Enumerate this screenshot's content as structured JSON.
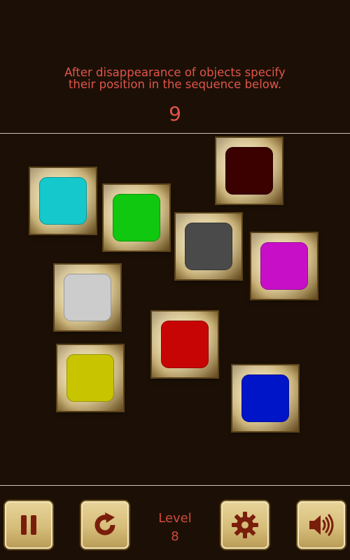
{
  "instruction": {
    "line1": "After disappearance of objects specify",
    "line2": "their position in the sequence below."
  },
  "counter": "9",
  "tiles": [
    {
      "name": "tile-dark-red",
      "color": "#3b0000"
    },
    {
      "name": "tile-cyan",
      "color": "#14c8cc"
    },
    {
      "name": "tile-green",
      "color": "#0fc80f"
    },
    {
      "name": "tile-dark-gray",
      "color": "#4a4a4a"
    },
    {
      "name": "tile-magenta",
      "color": "#c80fc8"
    },
    {
      "name": "tile-light-gray",
      "color": "#cccccc"
    },
    {
      "name": "tile-red",
      "color": "#c80505"
    },
    {
      "name": "tile-yellow",
      "color": "#c8c400"
    },
    {
      "name": "tile-blue",
      "color": "#0014c8"
    }
  ],
  "footer": {
    "level_label": "Level",
    "level_value": "8",
    "buttons": [
      "pause-icon",
      "restart-icon",
      "settings-gear-icon",
      "sound-icon"
    ]
  },
  "colors": {
    "background": "#1c1006",
    "text_accent": "#e0554a",
    "icon": "#7a1e0c",
    "button_gold": "#d6bd7a"
  }
}
